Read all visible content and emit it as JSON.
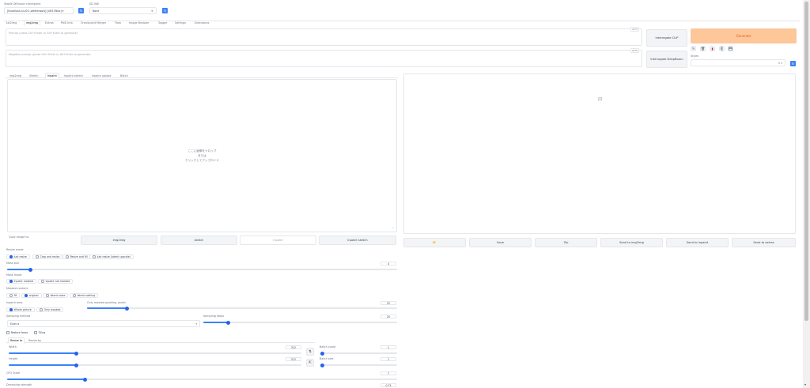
{
  "header": {
    "checkpoint_label": "Stable Diffusion checkpoint",
    "checkpoint_value": "[Illustrious-xl-v0.1.safetensors] [c8f13fb4c] ▾",
    "vae_label": "SD VAE",
    "vae_value": "None"
  },
  "main_tabs": [
    "txt2img",
    "img2img",
    "Extras",
    "PNG Info",
    "Checkpoint Merger",
    "Train",
    "Image Browser",
    "Tagger",
    "Settings",
    "Extensions"
  ],
  "prompt": {
    "placeholder": "Prompt (press Ctrl+Enter or Alt+Enter to generate)",
    "counter": "0/75"
  },
  "negative": {
    "placeholder": "Negative prompt (press Ctrl+Enter or Alt+Enter to generate)",
    "counter": "0/75"
  },
  "buttons": {
    "interrogate_clip": "Interrogate CLIP",
    "interrogate_deepbooru": "Interrogate DeepBooru",
    "generate": "Generate",
    "styles_label": "Styles"
  },
  "style_icons": [
    "pencil-icon",
    "trash-icon",
    "clipboard-icon",
    "copy-icon",
    "save-icon"
  ],
  "sub_tabs": [
    "img2img",
    "Sketch",
    "Inpaint",
    "Inpaint sketch",
    "Inpaint upload",
    "Batch"
  ],
  "canvas": {
    "drop_line1": "ここに画像をドロップ",
    "drop_line2": "または",
    "drop_line3": "クリックしてアップロード"
  },
  "copy": {
    "label": "Copy image to:",
    "buttons": [
      "img2img",
      "sketch",
      "inpaint",
      "inpaint sketch"
    ]
  },
  "output_buttons": [
    "📂",
    "Save",
    "Zip",
    "Send to img2img",
    "Send to inpaint",
    "Send to extras"
  ],
  "resize_mode": {
    "label": "Resize mode",
    "options": [
      "Just resize",
      "Crop and resize",
      "Resize and fill",
      "Just resize (latent upscale)"
    ],
    "selected": 0
  },
  "mask_blur": {
    "label": "Mask blur",
    "value": "4",
    "fraction": 0.06
  },
  "mask_mode": {
    "label": "Mask mode",
    "options": [
      "Inpaint masked",
      "Inpaint not masked"
    ],
    "selected": 0
  },
  "masked_content": {
    "label": "Masked content",
    "options": [
      "fill",
      "original",
      "latent noise",
      "latent nothing"
    ],
    "selected": 1
  },
  "inpaint_area": {
    "label": "Inpaint area",
    "options": [
      "Whole picture",
      "Only masked"
    ],
    "selected": 0
  },
  "padding": {
    "label": "Only masked padding, pixels",
    "value": "32",
    "fraction": 0.13
  },
  "sampling_method": {
    "label": "Sampling method",
    "value": "Euler a"
  },
  "sampling_steps": {
    "label": "Sampling steps",
    "value": "20",
    "fraction": 0.13
  },
  "checks": {
    "restore_faces": "Restore faces",
    "tiling": "Tiling"
  },
  "resize_tabs": [
    "Resize to",
    "Resize by"
  ],
  "width": {
    "label": "Width",
    "value": "512",
    "fraction": 0.23
  },
  "height": {
    "label": "Height",
    "value": "512",
    "fraction": 0.23
  },
  "batch_count": {
    "label": "Batch count",
    "value": "1",
    "fraction": 0.0
  },
  "batch_size": {
    "label": "Batch size",
    "value": "1",
    "fraction": 0.0
  },
  "cfg": {
    "label": "CFG Scale",
    "value": "7",
    "fraction": 0.2
  },
  "denoise": {
    "label": "Denoising strength",
    "value": "0.75"
  },
  "output_placeholder_icon": "image-icon",
  "colors": {
    "accent": "#3b82f6",
    "generate": "#fdc79a",
    "generate_text": "#ea580c"
  }
}
